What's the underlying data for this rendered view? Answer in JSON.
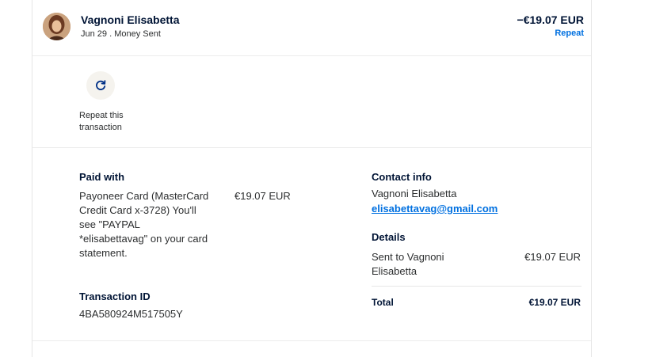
{
  "header": {
    "name": "Vagnoni Elisabetta",
    "subline": "Jun 29 . Money Sent",
    "amount": "−€19.07 EUR",
    "repeat_label": "Repeat"
  },
  "actions": {
    "repeat_transaction_label": "Repeat this transaction"
  },
  "paid_with": {
    "title": "Paid with",
    "description": "Payoneer Card (MasterCard Credit Card x-3728) You'll see \"PAYPAL *elisabettavag\" on your card statement.",
    "amount": "€19.07 EUR"
  },
  "transaction": {
    "title": "Transaction ID",
    "id": "4BA580924M517505Y"
  },
  "contact": {
    "title": "Contact info",
    "name": "Vagnoni Elisabetta",
    "email": "elisabettavag@gmail.com"
  },
  "details": {
    "title": "Details",
    "sent_to_label": "Sent to Vagnoni Elisabetta",
    "sent_to_amount": "€19.07 EUR",
    "total_label": "Total",
    "total_amount": "€19.07 EUR"
  },
  "colors": {
    "link": "#0070e0",
    "text_dark": "#001435",
    "icon_circle_bg": "#f5f3ee"
  }
}
